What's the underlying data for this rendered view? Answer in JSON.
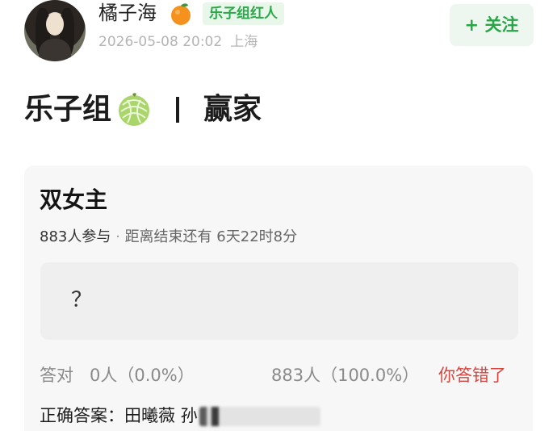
{
  "header": {
    "username": "橘子海",
    "group_badge": "乐子组红人",
    "date": "2026-05-08 20:02",
    "location": "上海",
    "follow_label": "+ 关注",
    "icons": {
      "avatar": "user-avatar",
      "username_emoji": "orange-icon"
    }
  },
  "post": {
    "group_name": "乐子组",
    "divider": "丨",
    "tag": "赢家",
    "group_icon": "melon-icon"
  },
  "quiz": {
    "title": "双女主",
    "participants": "883人参与",
    "separator": "·",
    "countdown": "距离结束还有 6天22时8分",
    "option": "？",
    "correct_label": "答对",
    "correct_count": "0人（0.0%）",
    "wrong_count": "883人（100.0%）",
    "wrong_tag": "你答错了",
    "answer_label": "正确答案：田曦薇 孙",
    "colors": {
      "accent_green": "#29a548",
      "wrong_red": "#d5463f",
      "card_bg": "#f7f7f7"
    }
  }
}
